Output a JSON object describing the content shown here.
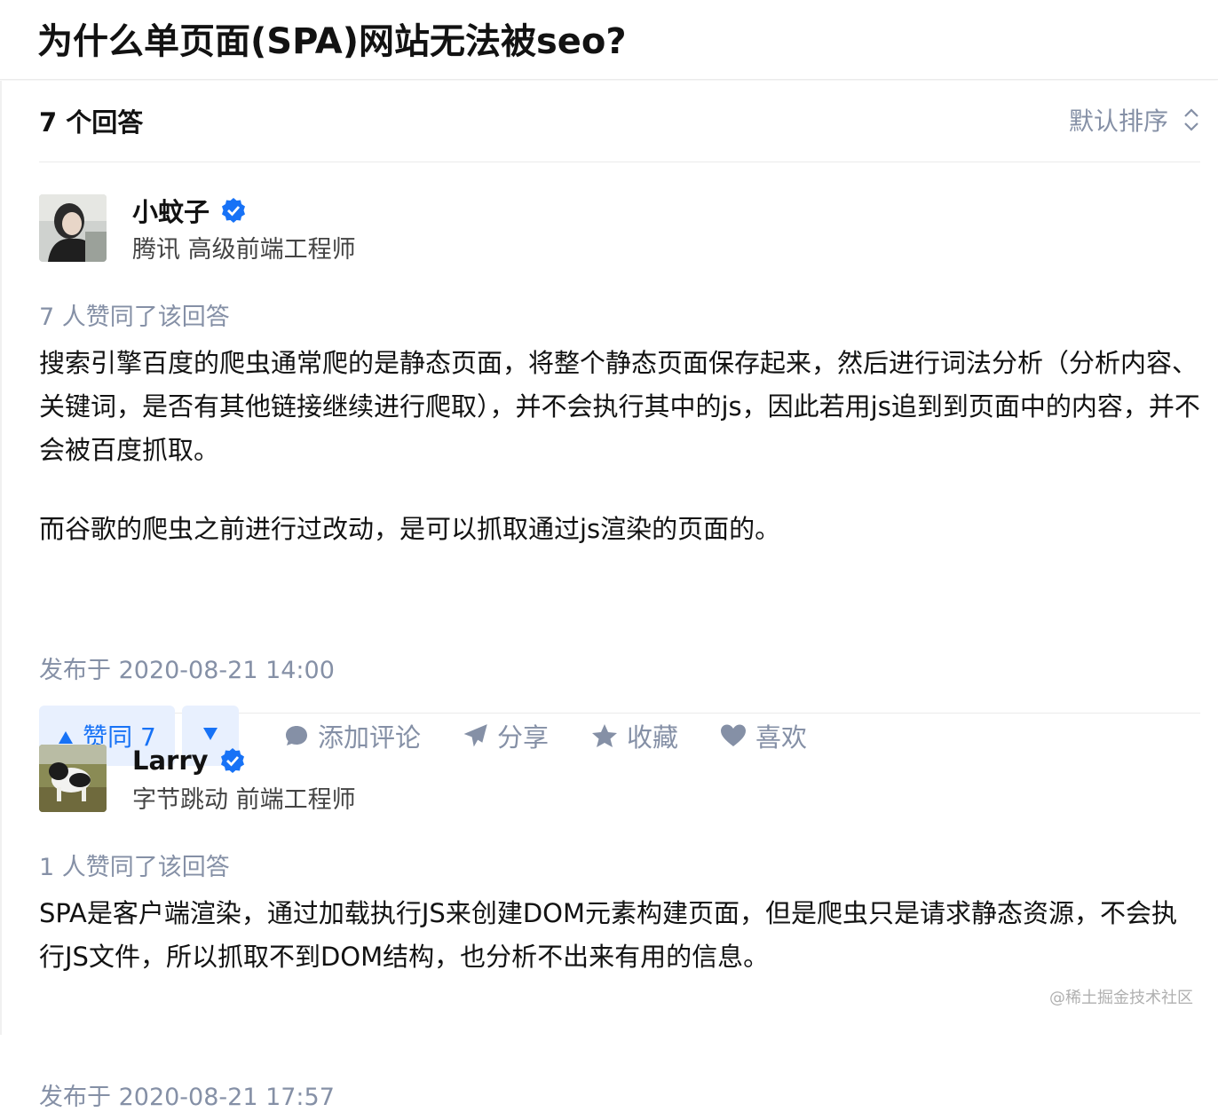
{
  "question": {
    "title": "为什么单页面(SPA)网站无法被seo?"
  },
  "list_header": {
    "count_label": "7 个回答",
    "sort_label": "默认排序"
  },
  "answers": [
    {
      "author": {
        "name": "小蚊子",
        "headline": "腾讯 高级前端工程师"
      },
      "vote_summary": "7 人赞同了该回答",
      "paragraphs": [
        "搜索引擎百度的爬虫通常爬的是静态页面，将整个静态页面保存起来，然后进行词法分析（分析内容、关键词，是否有其他链接继续进行爬取），并不会执行其中的js，因此若用js追到到页面中的内容，并不会被百度抓取。",
        "而谷歌的爬虫之前进行过改动，是可以抓取通过js渲染的页面的。"
      ],
      "publish_time": "发布于 2020-08-21 14:00",
      "actions": {
        "vote_up_label": "赞同 7",
        "comment_label": "添加评论",
        "share_label": "分享",
        "collect_label": "收藏",
        "like_label": "喜欢"
      }
    },
    {
      "author": {
        "name": "Larry",
        "headline": "字节跳动 前端工程师"
      },
      "vote_summary": "1 人赞同了该回答",
      "paragraphs": [
        "SPA是客户端渲染，通过加载执行JS来创建DOM元素构建页面，但是爬虫只是请求静态资源，不会执行JS文件，所以抓取不到DOM结构，也分析不出来有用的信息。"
      ],
      "publish_time": "发布于 2020-08-21 17:57"
    }
  ],
  "watermark": "@稀土掘金技术社区",
  "colors": {
    "accent": "#1772f6",
    "muted": "#8590a6",
    "vote_bg": "#e8f0fe"
  },
  "icons": [
    "verified-icon",
    "sort-icon",
    "triangle-up-icon",
    "triangle-down-icon",
    "comment-icon",
    "share-icon",
    "star-icon",
    "heart-icon"
  ]
}
